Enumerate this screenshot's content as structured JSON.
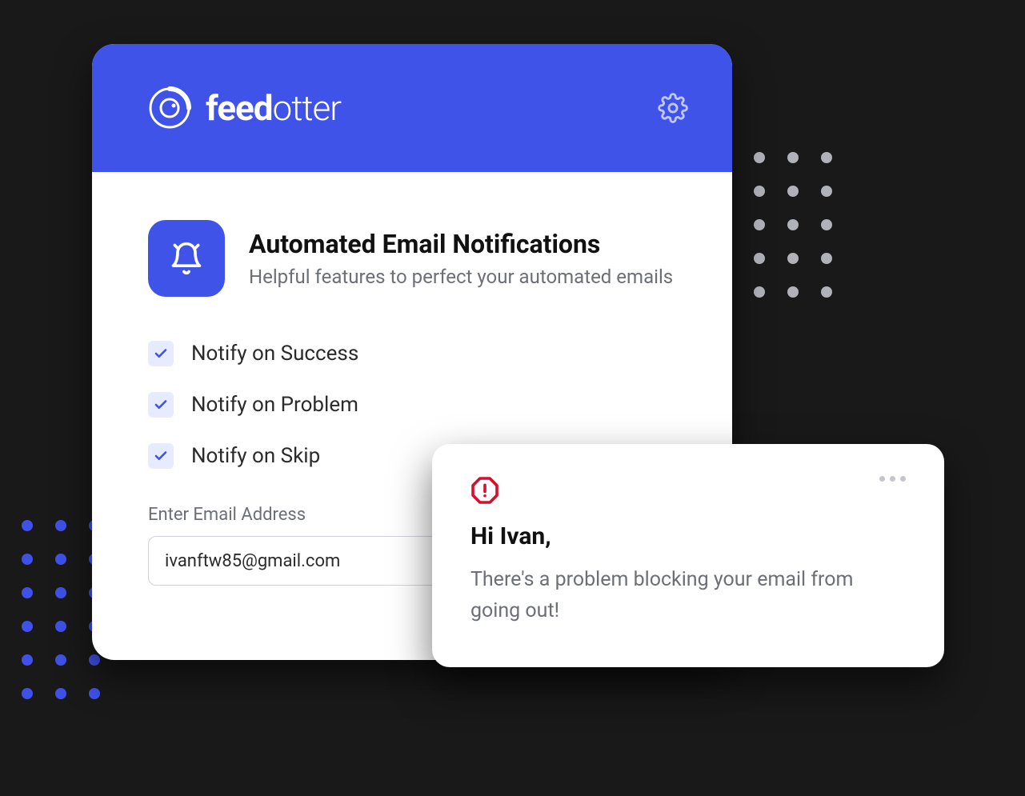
{
  "brand": {
    "name_bold": "feed",
    "name_light": "otter"
  },
  "header": {
    "title": "Automated Email Notifications",
    "subtitle": "Helpful features to perfect your automated emails"
  },
  "checks": [
    {
      "label": "Notify on Success"
    },
    {
      "label": "Notify on Problem"
    },
    {
      "label": "Notify on Skip"
    }
  ],
  "email": {
    "label": "Enter Email Address",
    "value": "ivanftw85@gmail.com"
  },
  "toast": {
    "greeting": "Hi Ivan,",
    "body": "There's a problem blocking your email from going out!"
  }
}
